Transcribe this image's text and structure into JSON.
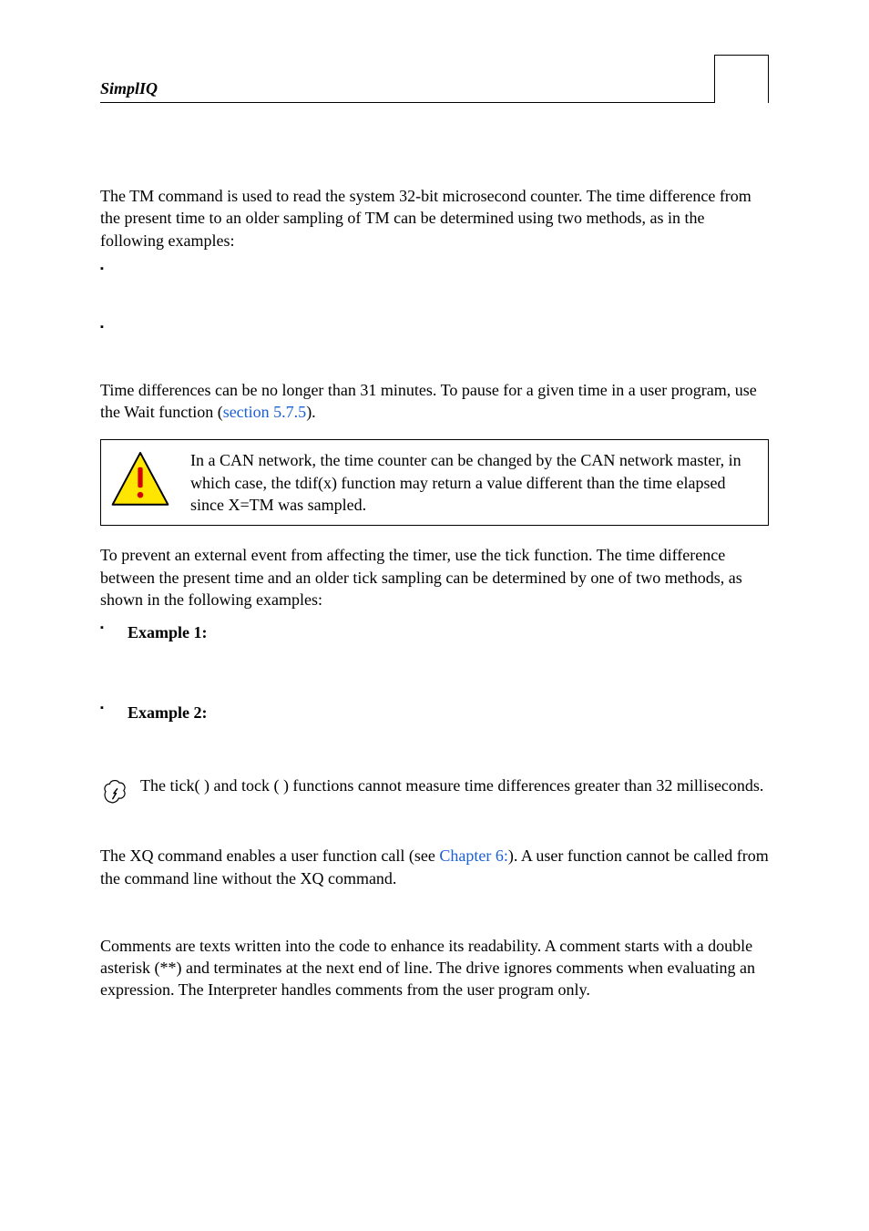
{
  "header": {
    "title": "SimplIQ"
  },
  "intro": "The TM command is used to read the system 32-bit microsecond counter. The time difference from the present time to an older sampling of TM can be determined using two methods, as in the following examples:",
  "examples_a": [
    " ",
    " "
  ],
  "time_diff": {
    "pre": "Time differences can be no longer than 31 minutes. To pause for a given time in a user program, use the Wait function (",
    "link": "section 5.7.5",
    "post": ")."
  },
  "callout": "In a CAN network, the time counter can be changed by the CAN network master, in which case, the tdif(x) function may return a value different than the time elapsed since X=TM was sampled.",
  "tick_intro": "To prevent an external event from affecting the timer, use the tick function. The time difference between the present time and an older tick sampling can be determined by one of two methods, as shown in the following examples:",
  "examples_b": [
    "Example 1:",
    "Example 2:"
  ],
  "note": "The tick( ) and tock ( ) functions cannot measure time differences greater than 32 milliseconds.",
  "xq": {
    "pre": "The XQ command enables a user function call (see ",
    "link": "Chapter 6:",
    "post": "). A user function cannot be called from the command line without the XQ command."
  },
  "comments": "Comments are texts written into the code to enhance its readability. A comment starts with a double asterisk (**) and terminates at the next end of line. The drive ignores comments when evaluating an expression. The Interpreter handles comments from the user program only."
}
